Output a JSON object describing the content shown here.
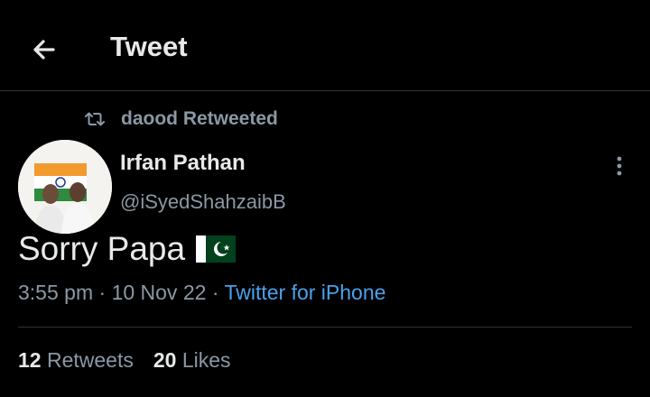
{
  "header": {
    "title": "Tweet"
  },
  "retweet": {
    "label": "daood Retweeted"
  },
  "author": {
    "name": "Irfan Pathan",
    "handle": "@iSyedShahzaibB"
  },
  "tweet": {
    "text": "Sorry Papa",
    "time": "3:55 pm",
    "date": "10 Nov 22",
    "source": "Twitter for iPhone",
    "flag_icon": "pakistan-flag"
  },
  "stats": {
    "retweets_count": "12",
    "retweets_label": "Retweets",
    "likes_count": "20",
    "likes_label": "Likes"
  },
  "colors": {
    "background": "#000000",
    "text": "#e7e9ea",
    "muted": "#8b98a5",
    "link": "#4ba1ea",
    "divider": "#2f3336"
  }
}
